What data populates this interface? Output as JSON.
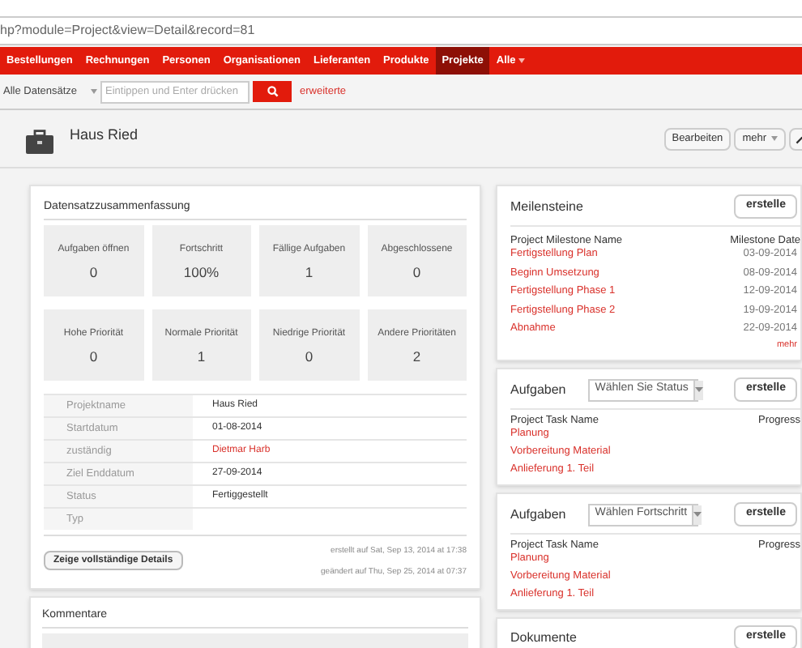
{
  "address_bar": {
    "url": "hp?module=Project&view=Detail&record=81"
  },
  "nav": [
    {
      "label": "Bestellungen",
      "selected": false
    },
    {
      "label": "Rechnungen",
      "selected": false
    },
    {
      "label": "Personen",
      "selected": false
    },
    {
      "label": "Organisationen",
      "selected": false
    },
    {
      "label": "Lieferanten",
      "selected": false
    },
    {
      "label": "Produkte",
      "selected": false
    },
    {
      "label": "Projekte",
      "selected": true
    },
    {
      "label": "Alle",
      "selected": false,
      "dropdown": true
    }
  ],
  "search": {
    "filter": "Alle Datensätze",
    "placeholder": "Eintippen und Enter drücken",
    "advanced": "erweiterte"
  },
  "record": {
    "title": "Haus Ried",
    "buttons": [
      "Bearbeiten",
      "mehr"
    ]
  },
  "summary": {
    "title": "Datensatzzusammenfassung",
    "tiles": [
      {
        "label": "Aufgaben öffnen",
        "value": "0"
      },
      {
        "label": "Fortschritt",
        "value": "100%"
      },
      {
        "label": "Fällige Aufgaben",
        "value": "1"
      },
      {
        "label": "Abgeschlossene",
        "value": "0"
      },
      {
        "label": "Hohe Priorität",
        "value": "0"
      },
      {
        "label": "Normale Priorität",
        "value": "1"
      },
      {
        "label": "Niedrige Priorität",
        "value": "0"
      },
      {
        "label": "Andere Prioritäten",
        "value": "2"
      }
    ],
    "fields": [
      {
        "label": "Projektname",
        "value": "Haus Ried",
        "link": false
      },
      {
        "label": "Startdatum",
        "value": "01-08-2014",
        "link": false
      },
      {
        "label": "zuständig",
        "value": "Dietmar Harb",
        "link": true
      },
      {
        "label": "Ziel Enddatum",
        "value": "27-09-2014",
        "link": false
      },
      {
        "label": "Status",
        "value": "Fertiggestellt",
        "link": false
      },
      {
        "label": "Typ"
      }
    ],
    "details_button": "Zeige vollständige Details",
    "created": "erstellt auf Sat, Sep 13, 2014 at 17:38",
    "modified": "geändert auf Thu, Sep 25, 2014 at 07:37"
  },
  "comments": {
    "title": "Kommentare"
  },
  "milestones": {
    "title": "Meilensteine",
    "button": "erstelle",
    "columns": [
      "Project Milestone Name",
      "Milestone Date"
    ],
    "rows": [
      {
        "name": "Fertigstellung Plan",
        "date": "03-09-2014"
      },
      {
        "name": "Beginn Umsetzung",
        "date": "08-09-2014"
      },
      {
        "name": "Fertigstellung Phase 1",
        "date": "12-09-2014"
      },
      {
        "name": "Fertigstellung Phase 2",
        "date": "19-09-2014"
      },
      {
        "name": "Abnahme",
        "date": "22-09-2014"
      }
    ],
    "more": "mehr"
  },
  "task_panels": [
    {
      "title": "Aufgaben",
      "select": "Wählen Sie Status",
      "button": "erstelle",
      "columns": [
        "Project Task Name",
        "Progress"
      ],
      "rows": [
        "Planung",
        "Vorbereitung Material",
        "Anlieferung 1. Teil"
      ]
    },
    {
      "title": "Aufgaben",
      "select": "Wählen Fortschritt",
      "button": "erstelle",
      "columns": [
        "Project Task Name",
        "Progress"
      ],
      "rows": [
        "Planung",
        "Vorbereitung Material",
        "Anlieferung 1. Teil"
      ]
    }
  ],
  "documents": {
    "title": "Dokumente",
    "button": "erstelle"
  }
}
